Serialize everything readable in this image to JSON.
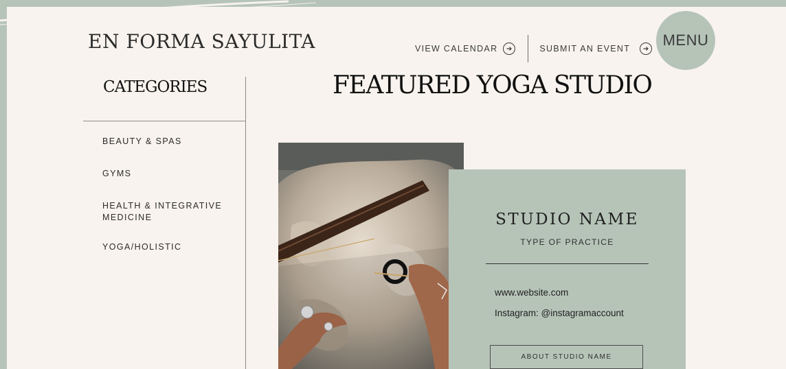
{
  "brand": {
    "name": "EN FORMA SAYULITA"
  },
  "nav": {
    "view_calendar": "VIEW CALENDAR",
    "submit_event": "SUBMIT AN EVENT",
    "menu": "MENU",
    "arrow_icon": "arrow-right-circle-icon"
  },
  "sidebar": {
    "title": "CATEGORIES",
    "items": [
      {
        "label": "BEAUTY & SPAS"
      },
      {
        "label": "GYMS"
      },
      {
        "label": "HEALTH & INTEGRATIVE MEDICINE"
      },
      {
        "label": "YOGA/HOLISTIC"
      }
    ]
  },
  "main": {
    "title": "FEATURED YOGA STUDIO",
    "studio": {
      "name": "STUDIO NAME",
      "practice": "TYPE OF PRACTICE",
      "website": "www.website.com",
      "instagram": "Instagram: @instagramaccount",
      "about_button": "ABOUT STUDIO NAME"
    }
  },
  "colors": {
    "sage": "#b6c4b8",
    "cream": "#f8f3ee",
    "text": "#2b2b2b"
  }
}
